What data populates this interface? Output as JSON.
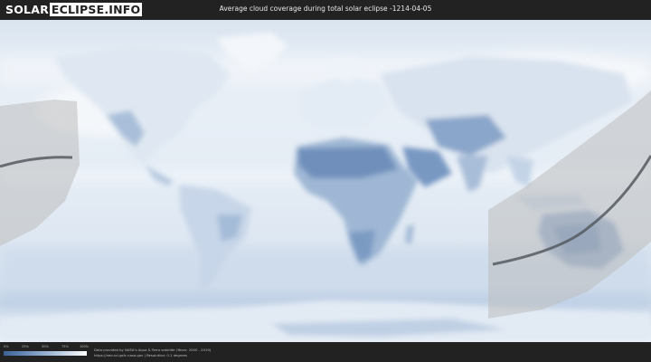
{
  "header": {
    "logo_part1": "SOLAR",
    "logo_part2": "ECLIPSE.INFO",
    "title": "Average cloud coverage during total solar eclipse -1214-04-05"
  },
  "colors": {
    "background": "#222222",
    "cloud_low": "#3b6296",
    "cloud_high": "#ffffff",
    "eclipse_band": "#c8c8c8",
    "central_line": "#555a60"
  },
  "legend": {
    "labels": [
      "0%",
      "25%",
      "50%",
      "75%",
      "100%"
    ]
  },
  "footer": {
    "credit_line1": "Data provided by NASA's Aqua & Terra satellite (Years: 2000 - 2019)",
    "credit_line2": "https://neo.sci.gsfc.nasa.gov | Resolution: 0.1 degrees"
  }
}
